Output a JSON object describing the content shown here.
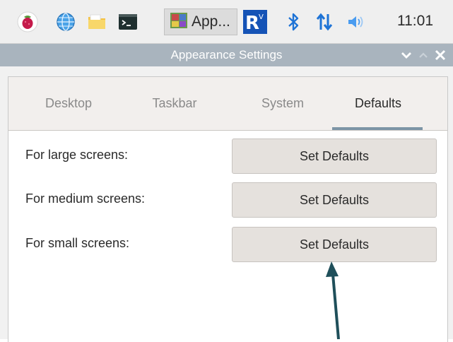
{
  "taskbar": {
    "icons": [
      {
        "name": "raspberry-menu-icon",
        "color": "#c51a4a"
      },
      {
        "name": "globe-browser-icon",
        "color": "#3a8fd6"
      },
      {
        "name": "folder-files-icon",
        "color": "#f5c242"
      },
      {
        "name": "terminal-icon",
        "color": "#1f2f2f"
      }
    ],
    "active_app": {
      "icon": "appearance-settings-icon",
      "label": "App..."
    },
    "tray": [
      {
        "name": "vnc-icon",
        "color": "#1553b6"
      },
      {
        "name": "bluetooth-icon",
        "color": "#1e73d6"
      },
      {
        "name": "network-transfer-icon",
        "color": "#1e73d6"
      },
      {
        "name": "volume-icon",
        "color": "#4a9cf0"
      }
    ],
    "clock": "11:01"
  },
  "window": {
    "title": "Appearance Settings",
    "controls": [
      "minimize",
      "maximize",
      "close"
    ]
  },
  "tabs": [
    {
      "id": "desktop",
      "label": "Desktop",
      "active": false
    },
    {
      "id": "taskbar",
      "label": "Taskbar",
      "active": false
    },
    {
      "id": "system",
      "label": "System",
      "active": false
    },
    {
      "id": "defaults",
      "label": "Defaults",
      "active": true
    }
  ],
  "defaults": {
    "rows": [
      {
        "label": "For large screens:",
        "button": "Set Defaults"
      },
      {
        "label": "For medium screens:",
        "button": "Set Defaults"
      },
      {
        "label": "For small screens:",
        "button": "Set Defaults"
      }
    ]
  },
  "colors": {
    "titlebar": "#a9b4be",
    "active_tab_underline": "#7d95a6",
    "annotation_arrow": "#1f4f5a"
  }
}
